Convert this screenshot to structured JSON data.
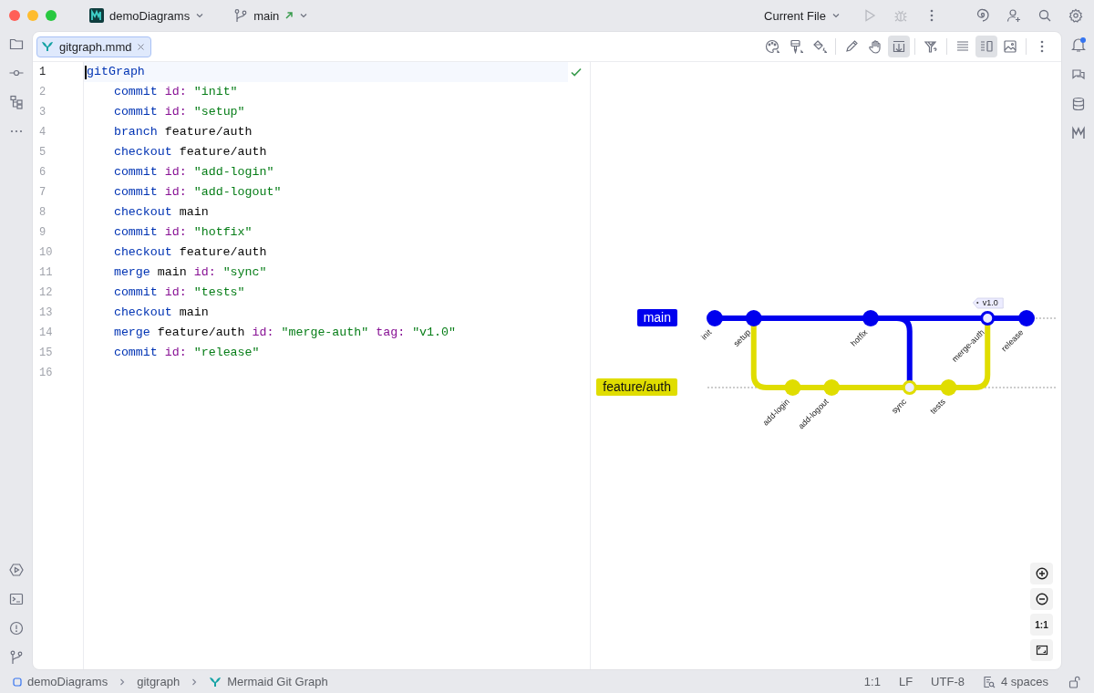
{
  "titlebar": {
    "project": "demoDiagrams",
    "branch": "main",
    "run_config": "Current File"
  },
  "tabs": [
    {
      "label": "gitgraph.mmd",
      "selected": true
    }
  ],
  "toolbar": [
    {
      "kind": "palette",
      "selected": false
    },
    {
      "kind": "brush",
      "selected": false
    },
    {
      "kind": "fill",
      "selected": false
    },
    {
      "kind": "separator"
    },
    {
      "kind": "pencil",
      "selected": false
    },
    {
      "kind": "hand",
      "selected": false
    },
    {
      "kind": "scroll-sync",
      "selected": true
    },
    {
      "kind": "separator"
    },
    {
      "kind": "help",
      "selected": false
    },
    {
      "kind": "separator"
    },
    {
      "kind": "editor-only",
      "selected": false
    },
    {
      "kind": "split",
      "selected": true
    },
    {
      "kind": "preview-only",
      "selected": false
    },
    {
      "kind": "separator"
    },
    {
      "kind": "more",
      "selected": false
    }
  ],
  "editor": {
    "lines": [
      {
        "number": "1",
        "current": true,
        "tokens": [
          {
            "text": "gitGraph",
            "kind": "keyword"
          }
        ],
        "children": [
          {
            "number": "2",
            "current": false,
            "tokens": [
              {
                "text": "commit",
                "kind": "keyword"
              },
              {
                "text": "id:",
                "kind": "attr"
              },
              {
                "text": "\"init\"",
                "kind": "string"
              }
            ]
          },
          {
            "number": "3",
            "current": false,
            "tokens": [
              {
                "text": "commit",
                "kind": "keyword"
              },
              {
                "text": "id:",
                "kind": "attr"
              },
              {
                "text": "\"setup\"",
                "kind": "string"
              }
            ]
          },
          {
            "number": "4",
            "current": false,
            "tokens": [
              {
                "text": "branch",
                "kind": "keyword"
              },
              {
                "text": "feature/auth",
                "kind": "plain"
              }
            ]
          },
          {
            "number": "5",
            "current": false,
            "tokens": [
              {
                "text": "checkout",
                "kind": "keyword"
              },
              {
                "text": "feature/auth",
                "kind": "plain"
              }
            ]
          },
          {
            "number": "6",
            "current": false,
            "tokens": [
              {
                "text": "commit",
                "kind": "keyword"
              },
              {
                "text": "id:",
                "kind": "attr"
              },
              {
                "text": "\"add-login\"",
                "kind": "string"
              }
            ]
          },
          {
            "number": "7",
            "current": false,
            "tokens": [
              {
                "text": "commit",
                "kind": "keyword"
              },
              {
                "text": "id:",
                "kind": "attr"
              },
              {
                "text": "\"add-logout\"",
                "kind": "string"
              }
            ]
          },
          {
            "number": "8",
            "current": false,
            "tokens": [
              {
                "text": "checkout",
                "kind": "keyword"
              },
              {
                "text": "main",
                "kind": "plain"
              }
            ]
          },
          {
            "number": "9",
            "current": false,
            "tokens": [
              {
                "text": "commit",
                "kind": "keyword"
              },
              {
                "text": "id:",
                "kind": "attr"
              },
              {
                "text": "\"hotfix\"",
                "kind": "string"
              }
            ]
          },
          {
            "number": "10",
            "current": false,
            "tokens": [
              {
                "text": "checkout",
                "kind": "keyword"
              },
              {
                "text": "feature/auth",
                "kind": "plain"
              }
            ]
          },
          {
            "number": "11",
            "current": false,
            "tokens": [
              {
                "text": "merge",
                "kind": "keyword"
              },
              {
                "text": "main",
                "kind": "plain"
              },
              {
                "text": "id:",
                "kind": "attr"
              },
              {
                "text": "\"sync\"",
                "kind": "string"
              }
            ]
          },
          {
            "number": "12",
            "current": false,
            "tokens": [
              {
                "text": "commit",
                "kind": "keyword"
              },
              {
                "text": "id:",
                "kind": "attr"
              },
              {
                "text": "\"tests\"",
                "kind": "string"
              }
            ]
          },
          {
            "number": "13",
            "current": false,
            "tokens": [
              {
                "text": "checkout",
                "kind": "keyword"
              },
              {
                "text": "main",
                "kind": "plain"
              }
            ]
          },
          {
            "number": "14",
            "current": false,
            "tokens": [
              {
                "text": "merge",
                "kind": "keyword"
              },
              {
                "text": "feature/auth",
                "kind": "plain"
              },
              {
                "text": "id:",
                "kind": "attr"
              },
              {
                "text": "\"merge-auth\"",
                "kind": "string"
              },
              {
                "text": "tag:",
                "kind": "attr"
              },
              {
                "text": "\"v1.0\"",
                "kind": "string"
              }
            ]
          },
          {
            "number": "15",
            "current": false,
            "tokens": [
              {
                "text": "commit",
                "kind": "keyword"
              },
              {
                "text": "id:",
                "kind": "attr"
              },
              {
                "text": "\"release\"",
                "kind": "string"
              }
            ]
          }
        ]
      },
      {
        "number": "16",
        "current": false
      }
    ]
  },
  "diagram": {
    "branches": [
      {
        "name": "main",
        "color": "#0000ee"
      },
      {
        "name": "feature/auth",
        "color": "#e0dd00"
      }
    ],
    "commits": [
      {
        "id": "init",
        "kind": "upper-commit"
      },
      {
        "id": "setup",
        "kind": "upper-commit"
      },
      {
        "id": "add-login",
        "kind": "lower-commit"
      },
      {
        "id": "add-logout",
        "kind": "lower-commit"
      },
      {
        "id": "hotfix",
        "kind": "upper-commit"
      },
      {
        "id": "sync",
        "kind": "lower-merge"
      },
      {
        "id": "tests",
        "kind": "lower-commit"
      },
      {
        "id": "merge-auth",
        "kind": "upper-merge",
        "tag": "v1.0"
      },
      {
        "id": "release",
        "kind": "upper-commit"
      }
    ]
  },
  "zoom_controls": {
    "actual_size": "1:1"
  },
  "breadcrumbs": [
    "demoDiagrams",
    "gitgraph",
    "Mermaid Git Graph"
  ],
  "status": {
    "position": "1:1",
    "line_ending": "LF",
    "encoding": "UTF-8",
    "indent": "4 spaces"
  }
}
